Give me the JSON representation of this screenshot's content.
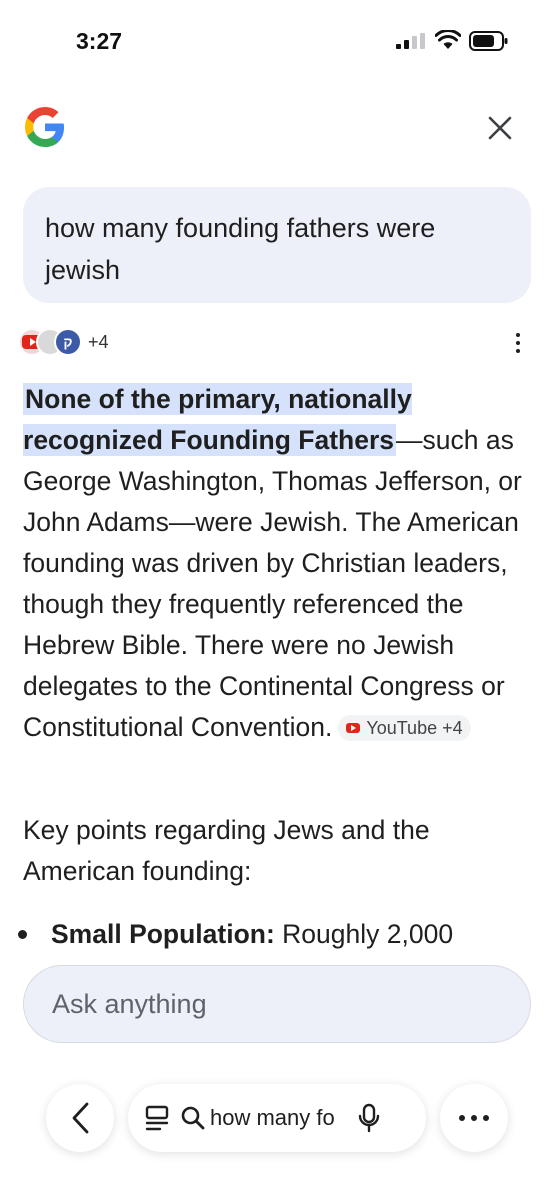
{
  "status_bar": {
    "time": "3:27"
  },
  "header": {
    "logo_icon": "google-g-icon",
    "close_icon": "close-icon"
  },
  "query": {
    "text": "how many founding fathers were jewish"
  },
  "sources": {
    "count_label": "+4",
    "favicons": [
      "youtube-icon",
      "site-icon",
      "site-icon"
    ]
  },
  "answer": {
    "highlight": "None of the primary, nationally recognized Founding Fathers",
    "body": "—such as George Washington, Thomas Jefferson, or John Adams—were Jewish. The American founding was driven by Christian leaders, though they frequently referenced the Hebrew Bible. There were no Jewish delegates to the Continental Congress or Constitutional Convention.",
    "citation": "YouTube +4"
  },
  "key_points": {
    "intro": "Key points regarding Jews and the American founding:",
    "items": [
      {
        "bold": "Small Population:",
        "text": " Roughly 2,000"
      }
    ]
  },
  "ask_bar": {
    "placeholder": "Ask anything"
  },
  "bottom_nav": {
    "search_text": "how many fo"
  },
  "colors": {
    "highlight": "#d6e2fb",
    "bubble": "#edf0f8",
    "youtube_red": "#e1251b"
  }
}
